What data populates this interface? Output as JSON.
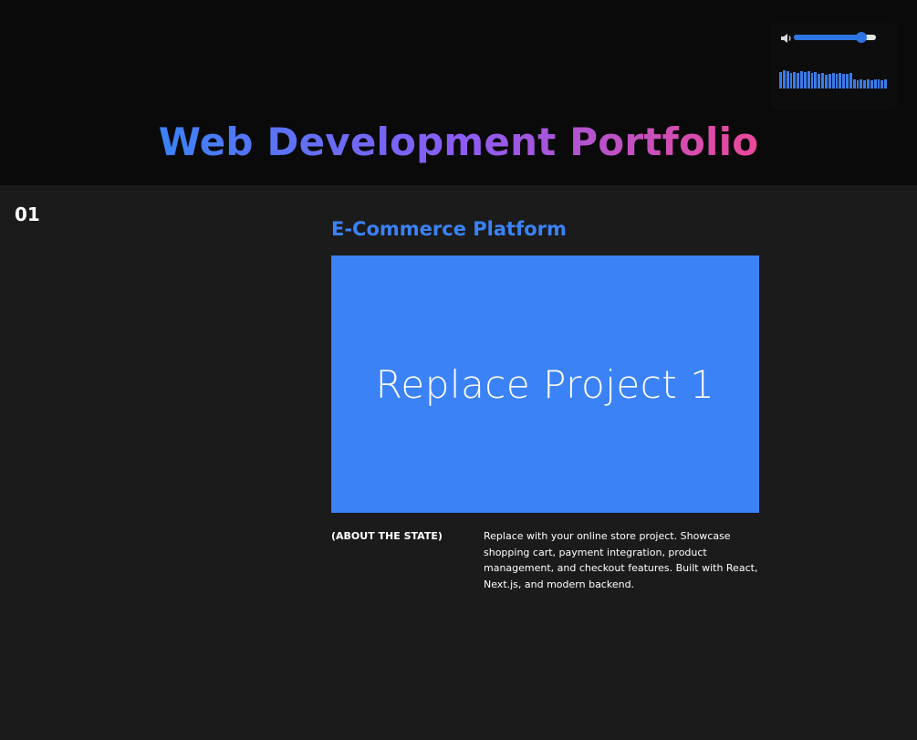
{
  "header": {
    "title": "Web Development Portfolio"
  },
  "audio": {
    "volume_icon": "speaker-icon",
    "volume_level": 0.82,
    "visualizer_levels": [
      0.9,
      1.0,
      0.95,
      0.85,
      0.9,
      0.85,
      0.95,
      0.9,
      0.95,
      0.85,
      0.9,
      0.8,
      0.85,
      0.75,
      0.8,
      0.85,
      0.8,
      0.85,
      0.8,
      0.8,
      0.85,
      0.5,
      0.45,
      0.5,
      0.45,
      0.5,
      0.45,
      0.5,
      0.5,
      0.45,
      0.5
    ],
    "accent_color": "#3b7be8"
  },
  "project": {
    "number": "01",
    "title": "E-Commerce Platform",
    "image_placeholder": "Replace Project 1",
    "about_label": "(ABOUT THE STATE)",
    "description": "Replace with your online store project. Showcase shopping cart, payment integration, product management, and checkout features. Built with React, Next.js, and modern backend."
  },
  "colors": {
    "accent": "#3b82f6",
    "gradient_start": "#3b82f6",
    "gradient_mid": "#8b5cf6",
    "gradient_end": "#ec4899",
    "header_bg": "#0a0a0a",
    "content_bg": "#1b1b1b"
  }
}
